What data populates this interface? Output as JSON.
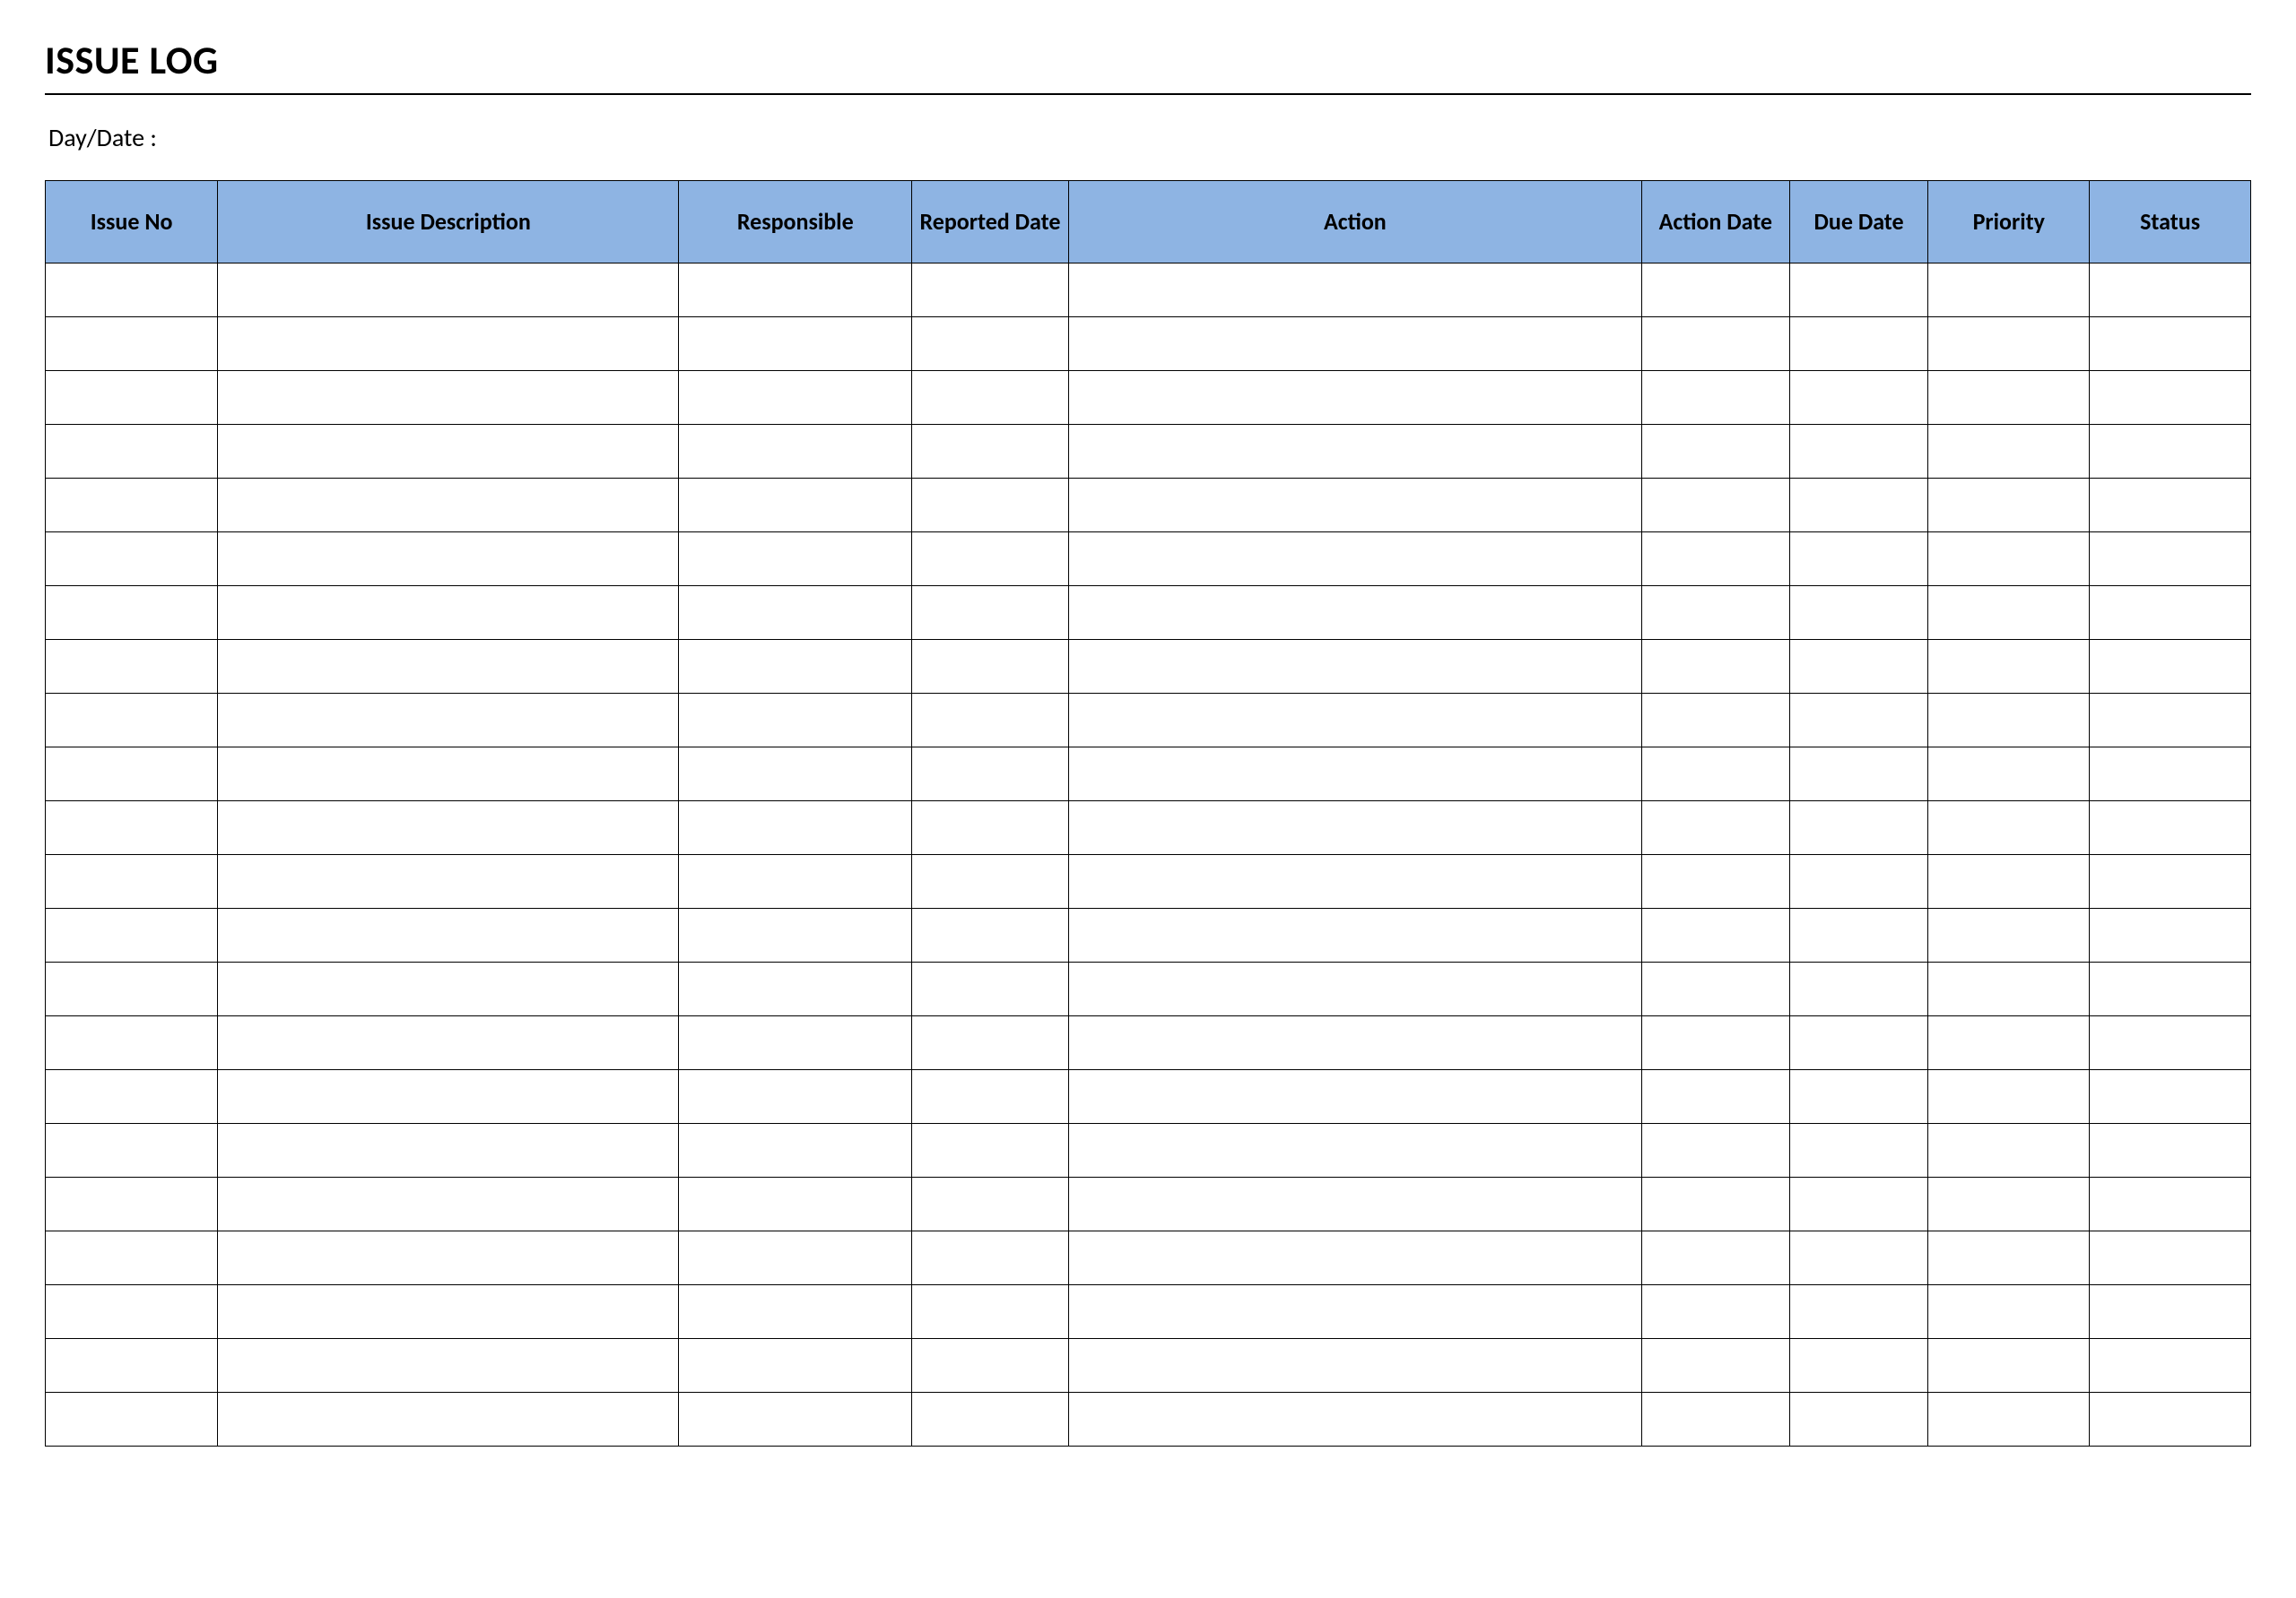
{
  "title": "ISSUE LOG",
  "daydate_label": "Day/Date :",
  "columns": [
    {
      "key": "issue_no",
      "label": "Issue No"
    },
    {
      "key": "description",
      "label": "Issue Description"
    },
    {
      "key": "responsible",
      "label": "Responsible"
    },
    {
      "key": "reported",
      "label": "Reported Date"
    },
    {
      "key": "action",
      "label": "Action"
    },
    {
      "key": "action_date",
      "label": "Action Date"
    },
    {
      "key": "due_date",
      "label": "Due Date"
    },
    {
      "key": "priority",
      "label": "Priority"
    },
    {
      "key": "status",
      "label": "Status"
    }
  ],
  "row_count": 22,
  "rows": [],
  "colors": {
    "header_bg": "#8eb4e3",
    "border": "#000000"
  }
}
